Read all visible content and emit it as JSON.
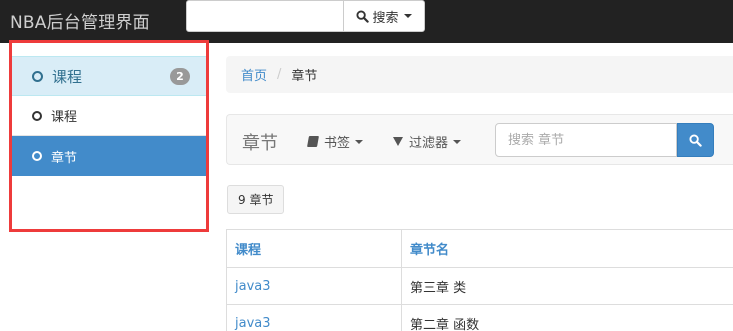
{
  "app": {
    "title": "NBA后台管理界面"
  },
  "topbar": {
    "search_placeholder": "",
    "search_button_label": "搜索"
  },
  "sidebar": {
    "header": {
      "label": "课程",
      "badge": "2"
    },
    "items": [
      {
        "label": "课程",
        "active": false
      },
      {
        "label": "章节",
        "active": true
      }
    ]
  },
  "breadcrumb": {
    "home": "首页",
    "separator": "/",
    "current": "章节"
  },
  "toolbar": {
    "title": "章节",
    "bookmarks_label": "书签",
    "filters_label": "过滤器",
    "search_placeholder": "搜索 章节"
  },
  "count": {
    "value": "9",
    "label": "章节"
  },
  "table": {
    "columns": [
      "课程",
      "章节名"
    ],
    "rows": [
      {
        "course": "java3",
        "chapter": "第三章 类"
      },
      {
        "course": "java3",
        "chapter": "第二章 函数"
      }
    ]
  },
  "colors": {
    "accent": "#428bca",
    "highlight_border": "#ee3b3b",
    "navbar": "#222222"
  }
}
